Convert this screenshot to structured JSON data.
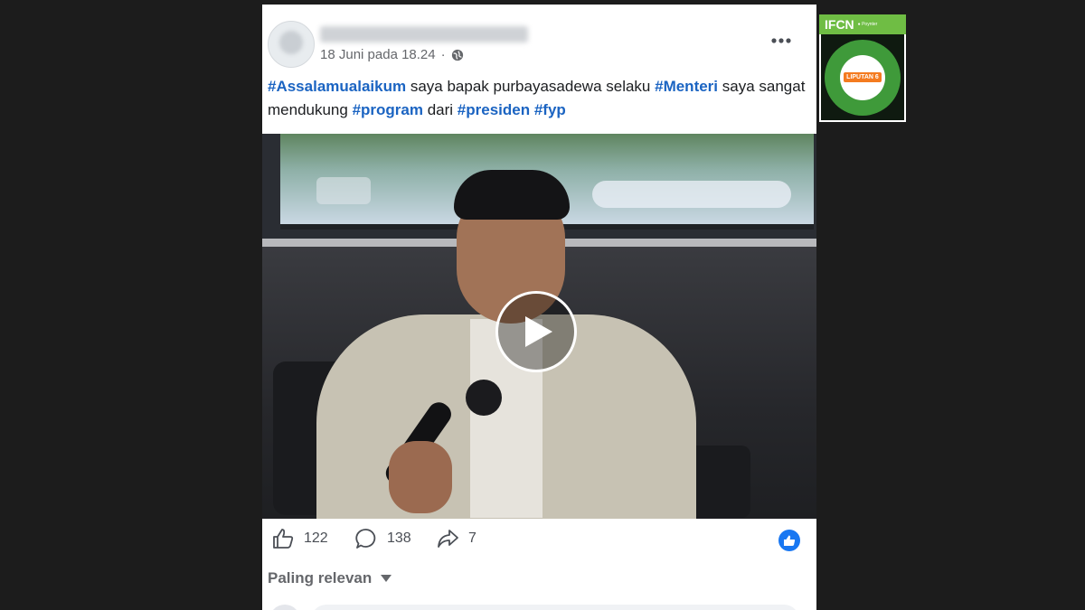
{
  "post": {
    "date": "18 Juni pada 18.24",
    "separator": "·",
    "caption": {
      "tag1": "#Assalamualaikum",
      "text1": " saya bapak purbayasadewa selaku ",
      "tag2": "#Menteri",
      "text2": " saya sangat mendukung ",
      "tag3": "#program",
      "text3": " dari ",
      "tag4": "#presiden",
      "text4": " ",
      "tag5": "#fyp"
    }
  },
  "stats": {
    "likes": "122",
    "comments": "138",
    "shares": "7"
  },
  "comments_section": {
    "sort_label": "Paling relevan"
  },
  "colors": {
    "hashtag": "#1b64c2",
    "like_badge": "#1877f2",
    "ifcn_green": "#6fbd44"
  },
  "icons": {
    "globe": "globe-icon",
    "more": "more-options-icon",
    "play": "play-icon",
    "like": "thumbs-up-icon",
    "comment": "comment-bubble-icon",
    "share": "share-arrow-icon",
    "sort": "chevron-down-icon"
  }
}
